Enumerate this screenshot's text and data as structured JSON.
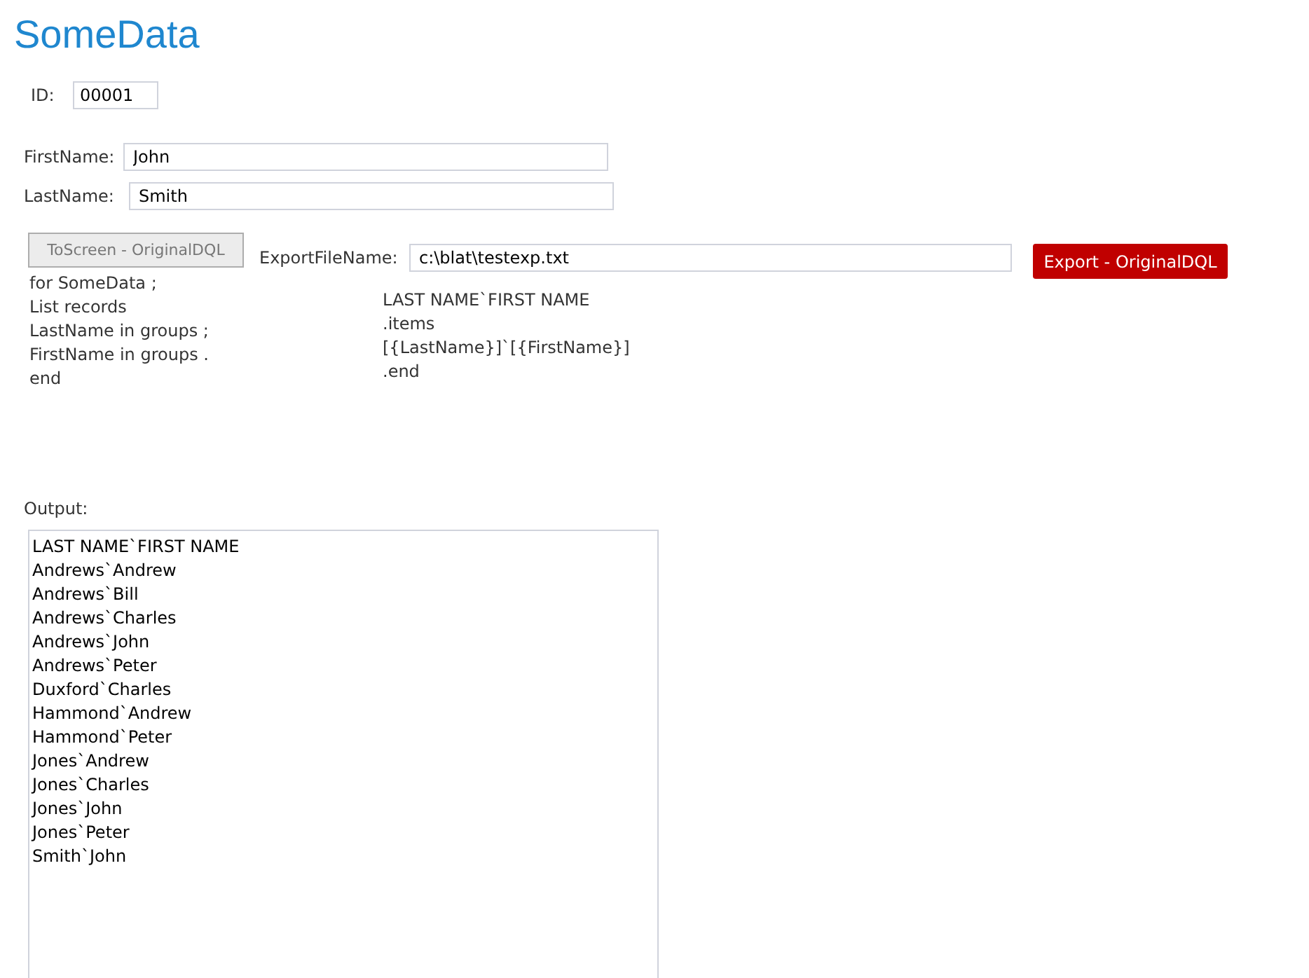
{
  "title": "SomeData",
  "id_field": {
    "label": "ID:",
    "value": "00001"
  },
  "first_name": {
    "label": "FirstName:",
    "value": "John"
  },
  "last_name": {
    "label": "LastName:",
    "value": "Smith"
  },
  "to_screen_button": {
    "label": "ToScreen - OriginalDQL",
    "disabled": true
  },
  "query_lines": [
    "for SomeData ;",
    "List records",
    "LastName in groups ;",
    "FirstName in groups .",
    "end"
  ],
  "export_file": {
    "label": "ExportFileName:",
    "value": "c:\\blat\\testexp.txt"
  },
  "template_lines": [
    "LAST NAME`FIRST NAME",
    ".items",
    "[{LastName}]`[{FirstName}]",
    ".end"
  ],
  "export_button": {
    "label": "Export - OriginalDQL",
    "disabled": false
  },
  "output": {
    "label": "Output:",
    "lines": [
      "LAST NAME`FIRST NAME",
      "Andrews`Andrew",
      "Andrews`Bill",
      "Andrews`Charles",
      "Andrews`John",
      "Andrews`Peter",
      "Duxford`Charles",
      "Hammond`Andrew",
      "Hammond`Peter",
      "Jones`Andrew",
      "Jones`Charles",
      "Jones`John",
      "Jones`Peter",
      "Smith`John"
    ]
  }
}
